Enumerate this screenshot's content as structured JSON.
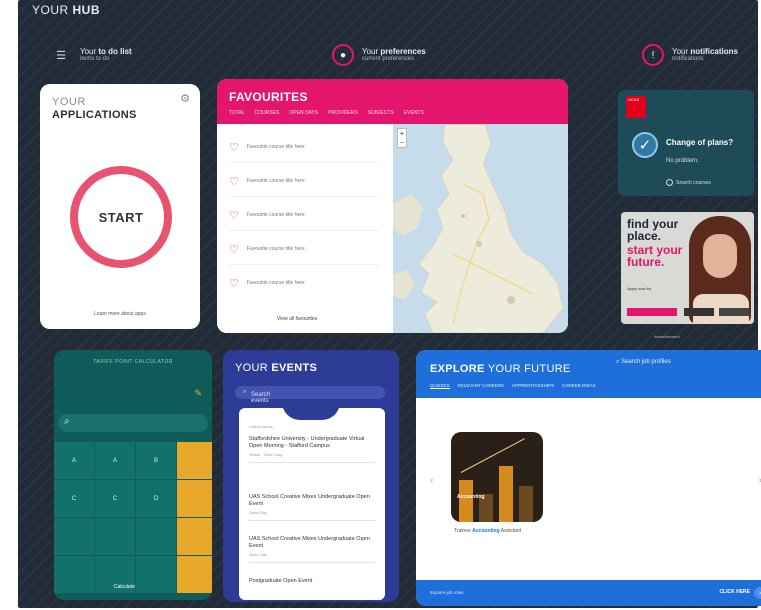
{
  "hub": {
    "title_prefix": "YOUR ",
    "title_bold": "HUB"
  },
  "quick_links": [
    {
      "icon": "list-icon",
      "title_prefix": "Your ",
      "title_bold": "to do list",
      "sub": "items to do"
    },
    {
      "icon": "person-icon",
      "title_prefix": "Your ",
      "title_bold": "preferences",
      "sub": "current preferences"
    },
    {
      "icon": "info-icon",
      "title_prefix": "Your ",
      "title_bold": "notifications",
      "sub": "notifications"
    }
  ],
  "applications": {
    "title_light": "YOUR",
    "title_bold": "APPLICATIONS",
    "start_label": "START",
    "footer": "Learn more about apps"
  },
  "favourites": {
    "title": "FAVOURITES",
    "tabs": [
      "Total",
      "Courses",
      "Open Days",
      "Providers",
      "Subjects",
      "Events"
    ],
    "items": [
      "Favourite course title here",
      "Favourite course title here",
      "Favourite course title here",
      "Favourite course title here",
      "Favourite course title here"
    ],
    "list_footer": "View all favourites",
    "map_zoom_in": "+",
    "map_zoom_out": "−"
  },
  "change_of_plans": {
    "logo_text": "UCAS",
    "question": "Change of plans?",
    "sub": "No problem.",
    "cta": "Search courses"
  },
  "ad": {
    "line1": "find your",
    "line1b": "place.",
    "line2": "start your",
    "line2b": "future.",
    "small": "Apply now for",
    "note": "Advertisement"
  },
  "calculator": {
    "title": "TARIFF POINT CALCULATOR",
    "grid": [
      "A",
      "A",
      "B",
      "",
      "C",
      "C",
      "D",
      "",
      "",
      "",
      "",
      "",
      "",
      "",
      "",
      ""
    ],
    "cta": "Calculate"
  },
  "events": {
    "title_light": "YOUR ",
    "title_bold": "EVENTS",
    "search": "Search events",
    "panel_label": "Latest events",
    "items": [
      {
        "title": "Staffordshire University - Undergraduate Virtual Open Morning - Stafford Campus",
        "meta": "Virtual · Open Day"
      },
      {
        "title": "UAS School Creative Mixes Undergraduate Open Event",
        "meta": "Open Day"
      },
      {
        "title": "UAS School Creative Mixes Undergraduate Open Event",
        "meta": "Open Day"
      },
      {
        "title": "Postgraduate Open Event",
        "meta": ""
      }
    ]
  },
  "explore": {
    "title_bold": "EXPLORE",
    "title_light": " YOUR FUTURE",
    "search": "Search job profiles",
    "tabs": [
      "Quizzes",
      "Relevant Careers",
      "Apprenticeships",
      "Career Ideas"
    ],
    "card_caption_prefix": "Trainee ",
    "card_caption_bold": "Accounting",
    "card_caption_suffix": " Assistant",
    "card_word": "Accounting",
    "footer_left": "Explore job roles",
    "footer_right": "CLICK HERE"
  }
}
